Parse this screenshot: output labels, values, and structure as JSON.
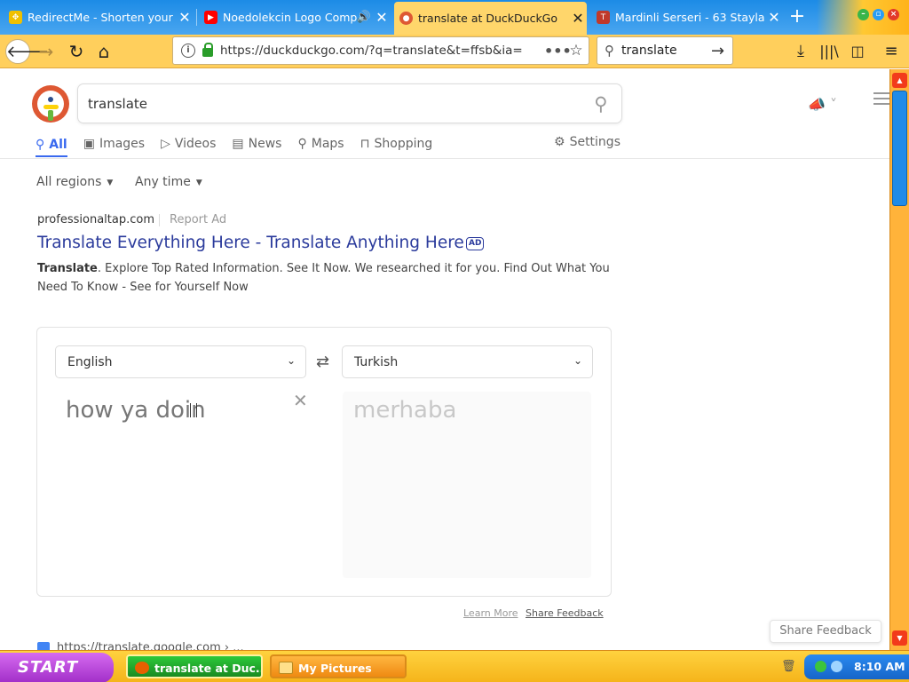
{
  "browser": {
    "tabs": [
      {
        "title": "RedirectMe - Shorten your L",
        "icon_color": "#f0c000",
        "active": false,
        "audio": false
      },
      {
        "title": "Noedolekcin Logo Compi",
        "icon_color": "#ff0000",
        "active": false,
        "audio": true
      },
      {
        "title": "translate at DuckDuckGo",
        "icon_color": "#de5833",
        "active": true,
        "audio": false
      },
      {
        "title": "Mardinli Serseri - 63 Stayla",
        "icon_color": "#c0392b",
        "active": false,
        "audio": false
      }
    ],
    "close_glyph": "✕",
    "new_tab_glyph": "+",
    "url": "https://duckduckgo.com/?q=translate&t=ffsb&ia=",
    "search_value": "translate"
  },
  "ddg": {
    "query": "translate",
    "nav_tabs": [
      {
        "label": "All",
        "icon": "search-icon",
        "active": true
      },
      {
        "label": "Images",
        "icon": "image-icon",
        "active": false
      },
      {
        "label": "Videos",
        "icon": "play-icon",
        "active": false
      },
      {
        "label": "News",
        "icon": "news-icon",
        "active": false
      },
      {
        "label": "Maps",
        "icon": "map-pin-icon",
        "active": false
      },
      {
        "label": "Shopping",
        "icon": "shopping-bag-icon",
        "active": false
      }
    ],
    "settings_label": "Settings",
    "filters": {
      "region": "All regions",
      "time": "Any time"
    },
    "ad": {
      "domain": "professionaltap.com",
      "report": "Report Ad",
      "title": "Translate Everything Here - Translate Anything Here",
      "badge": "AD",
      "snippet_bold": "Translate",
      "snippet_rest": ". Explore Top Rated Information. See It Now. We researched it for you. Find Out What You Need To Know - See for Yourself Now"
    },
    "translator": {
      "source_lang": "English",
      "target_lang": "Turkish",
      "source_text": "how ya doin",
      "target_text": "merhaba",
      "learn_more": "Learn More",
      "share_feedback": "Share Feedback"
    },
    "next_result_url": "https://translate.google.com › ...",
    "share_feedback_button": "Share Feedback",
    "accent_color": "#3969ef",
    "ad_link_color": "#2b3b9c"
  },
  "taskbar": {
    "start_label": "START",
    "tasks": [
      {
        "label": "translate at Duc...",
        "active": true
      },
      {
        "label": "My Pictures",
        "active": false
      }
    ],
    "clock": "8:10 AM"
  }
}
